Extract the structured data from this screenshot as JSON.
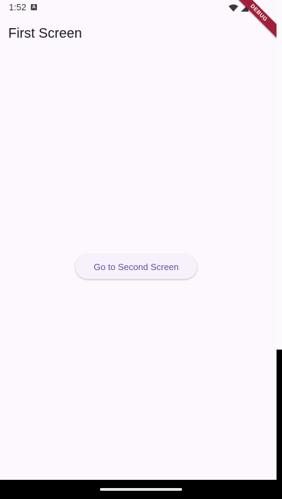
{
  "status_bar": {
    "time": "1:52",
    "notification_icon": "a-letter-icon",
    "icons": [
      "wifi-icon",
      "signal-icon",
      "battery-icon"
    ]
  },
  "debug_banner": {
    "label": "DEBUG"
  },
  "app_bar": {
    "title": "First Screen"
  },
  "main": {
    "button_label": "Go to Second Screen"
  },
  "colors": {
    "background": "#fcf8fd",
    "primary": "#6750a4",
    "button_surface": "#f6f1fa",
    "debug_banner": "#a0203b"
  }
}
